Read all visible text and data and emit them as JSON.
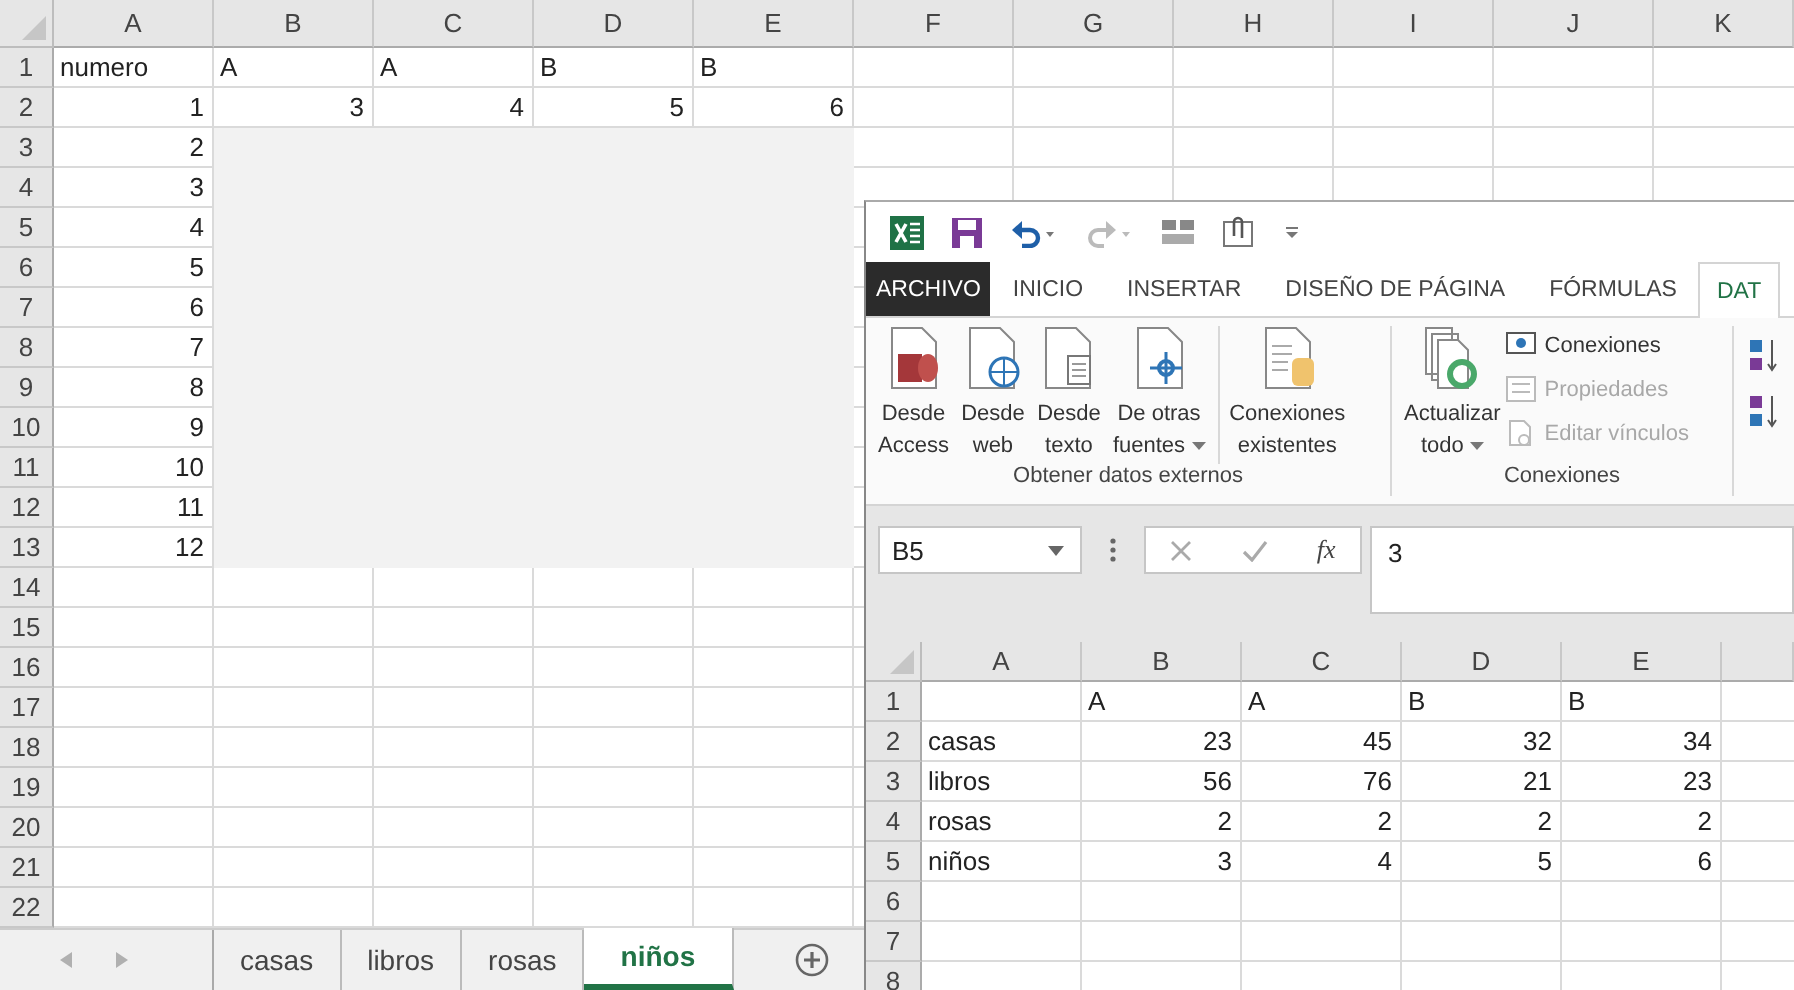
{
  "sheet": {
    "columns": [
      "A",
      "B",
      "C",
      "D",
      "E",
      "F",
      "G",
      "H",
      "I",
      "J",
      "K"
    ],
    "rows": [
      {
        "number": "1",
        "cells": [
          {
            "text": "numero",
            "kind": "text"
          },
          {
            "text": "A",
            "kind": "text"
          },
          {
            "text": "A",
            "kind": "text"
          },
          {
            "text": "B",
            "kind": "text"
          },
          {
            "text": "B",
            "kind": "text"
          }
        ]
      },
      {
        "number": "2",
        "cells": [
          {
            "text": "1",
            "kind": "number"
          },
          {
            "text": "3",
            "kind": "number"
          },
          {
            "text": "4",
            "kind": "number"
          },
          {
            "text": "5",
            "kind": "number"
          },
          {
            "text": "6",
            "kind": "number"
          }
        ]
      },
      {
        "number": "3",
        "cells": [
          {
            "text": "2",
            "kind": "number"
          }
        ]
      },
      {
        "number": "4",
        "cells": [
          {
            "text": "3",
            "kind": "number"
          }
        ]
      },
      {
        "number": "5",
        "cells": [
          {
            "text": "4",
            "kind": "number"
          }
        ]
      },
      {
        "number": "6",
        "cells": [
          {
            "text": "5",
            "kind": "number"
          }
        ]
      },
      {
        "number": "7",
        "cells": [
          {
            "text": "6",
            "kind": "number"
          }
        ]
      },
      {
        "number": "8",
        "cells": [
          {
            "text": "7",
            "kind": "number"
          }
        ]
      },
      {
        "number": "9",
        "cells": [
          {
            "text": "8",
            "kind": "number"
          }
        ]
      },
      {
        "number": "10",
        "cells": [
          {
            "text": "9",
            "kind": "number"
          }
        ]
      },
      {
        "number": "11",
        "cells": [
          {
            "text": "10",
            "kind": "number"
          }
        ]
      },
      {
        "number": "12",
        "cells": [
          {
            "text": "11",
            "kind": "number"
          }
        ]
      },
      {
        "number": "13",
        "cells": [
          {
            "text": "12",
            "kind": "number"
          }
        ]
      },
      {
        "number": "14"
      },
      {
        "number": "15"
      },
      {
        "number": "16"
      },
      {
        "number": "17"
      },
      {
        "number": "18"
      },
      {
        "number": "19"
      },
      {
        "number": "20"
      },
      {
        "number": "21"
      },
      {
        "number": "22"
      }
    ]
  },
  "sheet_tabs": [
    {
      "label": "casas",
      "selected": false
    },
    {
      "label": "libros",
      "selected": false
    },
    {
      "label": "rosas",
      "selected": false
    },
    {
      "label": "niños",
      "selected": true
    }
  ],
  "excel_window": {
    "ribbon_tabs": [
      {
        "label": "ARCHIVO",
        "kind": "file",
        "selected": false
      },
      {
        "label": "INICIO",
        "kind": "tab",
        "selected": false
      },
      {
        "label": "INSERTAR",
        "kind": "tab",
        "selected": false
      },
      {
        "label": "DISEÑO DE PÁGINA",
        "kind": "tab",
        "selected": false
      },
      {
        "label": "FÓRMULAS",
        "kind": "tab",
        "selected": false
      },
      {
        "label": "DAT",
        "kind": "tab",
        "selected": true
      }
    ],
    "groups": [
      {
        "label": "Obtener datos externos",
        "buttons": [
          {
            "lines": [
              "Desde",
              "Access"
            ],
            "has_menu": false
          },
          {
            "lines": [
              "Desde",
              "web"
            ],
            "has_menu": false
          },
          {
            "lines": [
              "Desde",
              "texto"
            ],
            "has_menu": false
          },
          {
            "lines": [
              "De otras",
              "fuentes"
            ],
            "has_menu": true
          },
          {
            "lines": [
              "Conexiones",
              "existentes"
            ],
            "has_menu": false
          }
        ]
      },
      {
        "label": "Conexiones",
        "buttons": [
          {
            "lines": [
              "Actualizar",
              "todo"
            ],
            "has_menu": true
          }
        ],
        "small_buttons": [
          {
            "label": "Conexiones",
            "disabled": false
          },
          {
            "label": "Propiedades",
            "disabled": true
          },
          {
            "label": "Editar vínculos",
            "disabled": true
          }
        ]
      }
    ],
    "name_box": "B5",
    "function_label": "fx",
    "formula": "3",
    "columns": [
      "A",
      "B",
      "C",
      "D",
      "E"
    ],
    "rows": [
      {
        "number": "1",
        "cells": [
          null,
          {
            "text": "A",
            "kind": "text"
          },
          {
            "text": "A",
            "kind": "text"
          },
          {
            "text": "B",
            "kind": "text"
          },
          {
            "text": "B",
            "kind": "text"
          }
        ]
      },
      {
        "number": "2",
        "cells": [
          {
            "text": "casas",
            "kind": "text"
          },
          {
            "text": "23",
            "kind": "number"
          },
          {
            "text": "45",
            "kind": "number"
          },
          {
            "text": "32",
            "kind": "number"
          },
          {
            "text": "34",
            "kind": "number"
          }
        ]
      },
      {
        "number": "3",
        "cells": [
          {
            "text": "libros",
            "kind": "text"
          },
          {
            "text": "56",
            "kind": "number"
          },
          {
            "text": "76",
            "kind": "number"
          },
          {
            "text": "21",
            "kind": "number"
          },
          {
            "text": "23",
            "kind": "number"
          }
        ]
      },
      {
        "number": "4",
        "cells": [
          {
            "text": "rosas",
            "kind": "text"
          },
          {
            "text": "2",
            "kind": "number"
          },
          {
            "text": "2",
            "kind": "number"
          },
          {
            "text": "2",
            "kind": "number"
          },
          {
            "text": "2",
            "kind": "number"
          }
        ]
      },
      {
        "number": "5",
        "cells": [
          {
            "text": "niños",
            "kind": "text"
          },
          {
            "text": "3",
            "kind": "number"
          },
          {
            "text": "4",
            "kind": "number"
          },
          {
            "text": "5",
            "kind": "number"
          },
          {
            "text": "6",
            "kind": "number"
          }
        ]
      },
      {
        "number": "6"
      },
      {
        "number": "7"
      },
      {
        "number": "8"
      }
    ]
  }
}
